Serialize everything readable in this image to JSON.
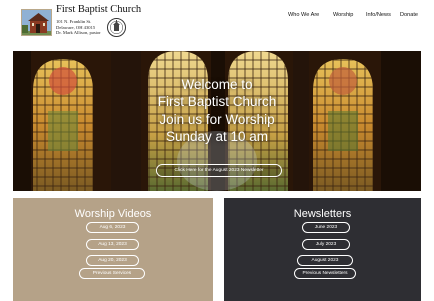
{
  "site": {
    "title": "First Baptist Church",
    "address_lines": [
      "101 N. Franklin St.",
      "Delaware, OH 43015",
      "Dr. Mark Allison, pastor"
    ]
  },
  "nav": {
    "items": [
      "Who We Are",
      "Worship",
      "Info/News",
      "Donate"
    ]
  },
  "hero": {
    "lines": [
      "Welcome to",
      "First Baptist Church",
      "Join us for Worship",
      "Sunday at 10 am"
    ],
    "button_label": "Click Here for the August 2023 Newsletter"
  },
  "worship_videos": {
    "title": "Worship Videos",
    "buttons": [
      "Aug 6, 2023",
      "Aug 13, 2023",
      "Aug 20, 2023",
      "Previous Services"
    ]
  },
  "newsletters": {
    "title": "Newsletters",
    "buttons": [
      "June 2023",
      "July 2023",
      "August 2023",
      "Previous Newsletters"
    ]
  },
  "colors": {
    "worship_panel": "#b5a288",
    "newsletter_panel": "#2e2e33",
    "text_light": "#ffffff"
  },
  "icons": {
    "church_photo": "church-photo-icon",
    "seal": "seal-icon"
  }
}
